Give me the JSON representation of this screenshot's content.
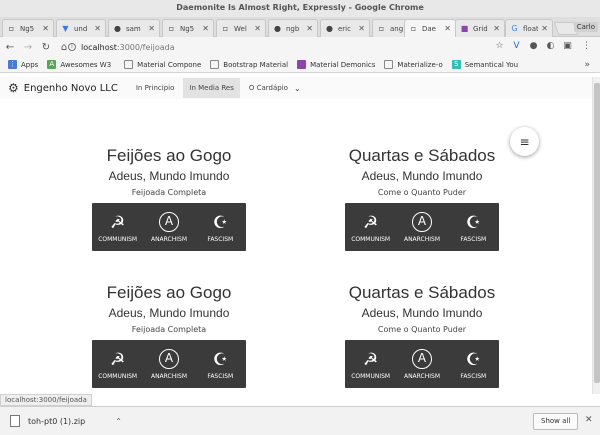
{
  "window": {
    "title": "Daemonite Is Almost Right, Expressly - Google Chrome"
  },
  "tabs": [
    {
      "label": "Ng5",
      "icon": "page-icon",
      "active": false
    },
    {
      "label": "und",
      "icon": "bookmark-icon",
      "active": false
    },
    {
      "label": "sam",
      "icon": "github-icon",
      "active": false
    },
    {
      "label": "Ng5",
      "icon": "page-icon",
      "active": false
    },
    {
      "label": "Wel",
      "icon": "page-icon",
      "active": false
    },
    {
      "label": "ngb",
      "icon": "github-icon",
      "active": false
    },
    {
      "label": "eric",
      "icon": "github-icon",
      "active": false
    },
    {
      "label": "ang",
      "icon": "page-icon",
      "active": false
    },
    {
      "label": "Dae",
      "icon": "page-icon",
      "active": true
    },
    {
      "label": "Grid",
      "icon": "materialize-icon",
      "active": false
    },
    {
      "label": "float",
      "icon": "google-icon",
      "active": false
    }
  ],
  "user_chip": "Carlo",
  "address": {
    "host": "localhost",
    "path": ":3000/feijoada"
  },
  "bookmarks": [
    {
      "label": "Apps",
      "icon": "apps-icon",
      "color": "#4a7bd4"
    },
    {
      "label": "Awesomes W3",
      "icon": "awesome-icon",
      "color": "#5aa15a"
    },
    {
      "label": "Material Compone",
      "icon": "page-icon",
      "color": "#888888"
    },
    {
      "label": "Bootstrap Material",
      "icon": "page-icon",
      "color": "#888888"
    },
    {
      "label": "Material Demonics",
      "icon": "materialize-icon",
      "color": "#8e44ad"
    },
    {
      "label": "Materialize-o",
      "icon": "page-icon",
      "color": "#888888"
    },
    {
      "label": "Semantical You",
      "icon": "semantic-icon",
      "color": "#35bdb2"
    }
  ],
  "appbar": {
    "brand": "Engenho Novo LLC",
    "menu": [
      {
        "label": "In Principio",
        "active": false
      },
      {
        "label": "In Media Res",
        "active": true
      },
      {
        "label": "O Cardápio",
        "active": false,
        "dropdown": true
      }
    ]
  },
  "cards": [
    {
      "title": "Feijões ao Gogo",
      "subtitle": "Adeus, Mundo Imundo",
      "desc": "Feijoada Completa",
      "icons": [
        {
          "label": "COMMUNISM",
          "glyph": "☭"
        },
        {
          "label": "ANARCHISM",
          "glyph": "A"
        },
        {
          "label": "FASCISM",
          "glyph": "☪"
        }
      ]
    },
    {
      "title": "Quartas e Sábados",
      "subtitle": "Adeus, Mundo Imundo",
      "desc": "Come o Quanto Puder",
      "icons": [
        {
          "label": "COMMUNISM",
          "glyph": "☭"
        },
        {
          "label": "ANARCHISM",
          "glyph": "A"
        },
        {
          "label": "FASCISM",
          "glyph": "☪"
        }
      ]
    },
    {
      "title": "Feijões ao Gogo",
      "subtitle": "Adeus, Mundo Imundo",
      "desc": "Feijoada Completa",
      "icons": [
        {
          "label": "COMMUNISM",
          "glyph": "☭"
        },
        {
          "label": "ANARCHISM",
          "glyph": "A"
        },
        {
          "label": "FASCISM",
          "glyph": "☪"
        }
      ]
    },
    {
      "title": "Quartas e Sábados",
      "subtitle": "Adeus, Mundo Imundo",
      "desc": "Come o Quanto Puder",
      "icons": [
        {
          "label": "COMMUNISM",
          "glyph": "☭"
        },
        {
          "label": "ANARCHISM",
          "glyph": "A"
        },
        {
          "label": "FASCISM",
          "glyph": "☪"
        }
      ]
    }
  ],
  "fab_icon": "menu-icon",
  "status_link": "localhost:3000/feijoada",
  "downloads": {
    "file": "toh-pt0 (1).zip",
    "show_all": "Show all"
  },
  "colors": {
    "icon_panel": "#3b3b3b",
    "active_menu": "#e2e2e2"
  }
}
